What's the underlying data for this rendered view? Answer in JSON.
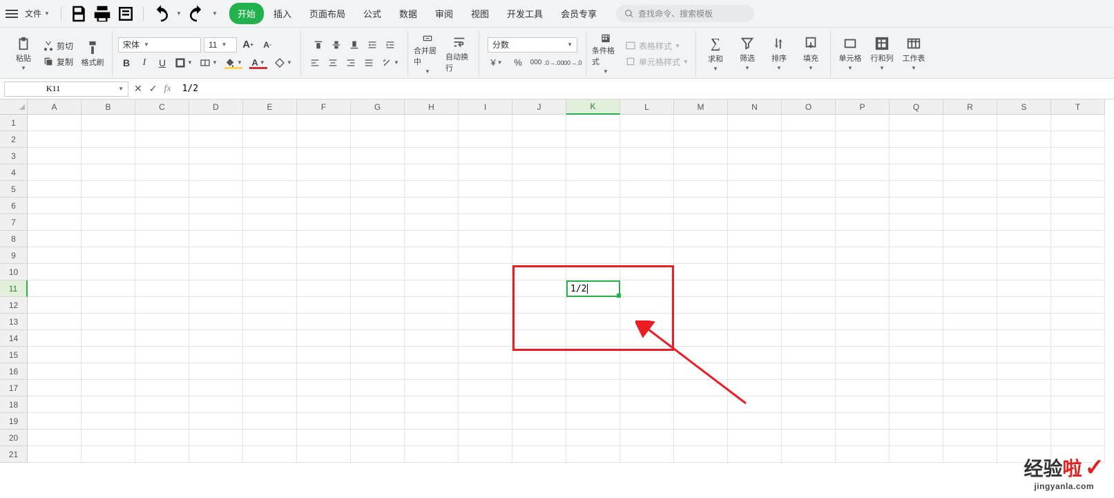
{
  "topbar": {
    "file_label": "文件"
  },
  "tabs": {
    "start": "开始",
    "insert": "插入",
    "layout": "页面布局",
    "formula": "公式",
    "data": "数据",
    "review": "审阅",
    "view": "视图",
    "dev": "开发工具",
    "vip": "会员专享"
  },
  "search": {
    "placeholder": "查找命令、搜索模板"
  },
  "ribbon": {
    "paste": "粘贴",
    "cut": "剪切",
    "copy": "复制",
    "fmtpainter": "格式刷",
    "font_name": "宋体",
    "font_size": "11",
    "merge": "合并居中",
    "wrap": "自动换行",
    "num_format": "分数",
    "cond_fmt": "条件格式",
    "table_style": "表格样式",
    "cell_style": "单元格样式",
    "sum": "求和",
    "filter": "筛选",
    "sort": "排序",
    "fill": "填充",
    "cell": "单元格",
    "rowcol": "行和列",
    "sheet": "工作表"
  },
  "fx": {
    "name_box": "K11",
    "formula": "1/2"
  },
  "grid": {
    "columns": [
      "A",
      "B",
      "C",
      "D",
      "E",
      "F",
      "G",
      "H",
      "I",
      "J",
      "K",
      "L",
      "M",
      "N",
      "O",
      "P",
      "Q",
      "R",
      "S",
      "T"
    ],
    "rows": 21,
    "active_col": "K",
    "active_row": 11,
    "cell_value": "1/2"
  },
  "watermark": {
    "main1": "经验",
    "main2": "啦",
    "check": "✓",
    "sub": "jingyanla.com"
  }
}
